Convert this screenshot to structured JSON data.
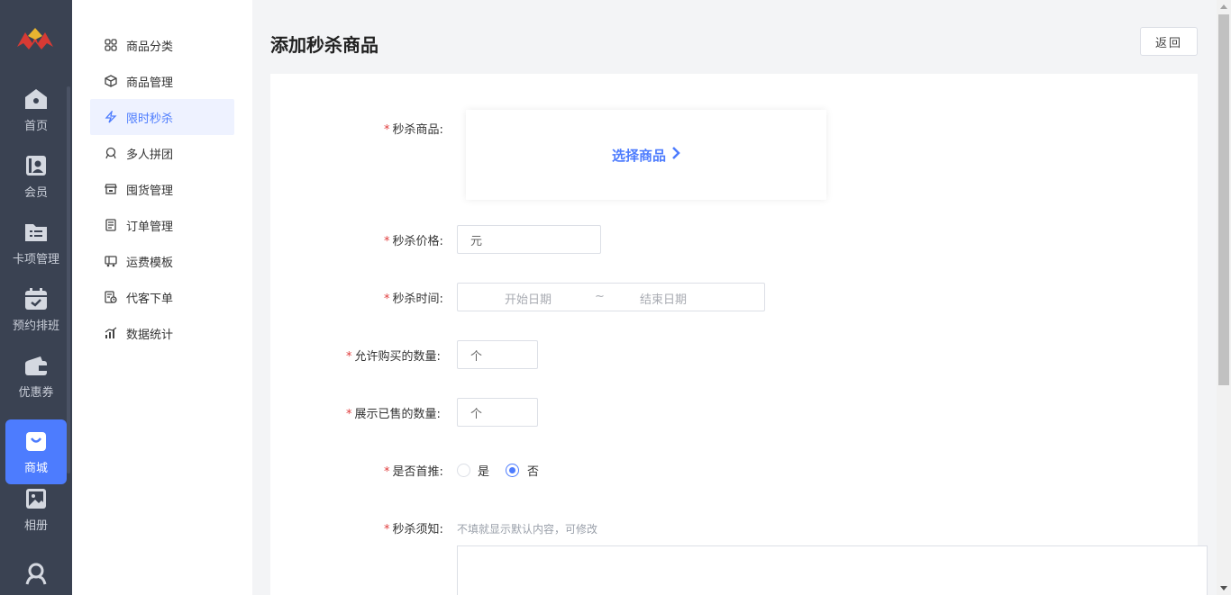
{
  "rail": {
    "items": [
      {
        "label": "首页",
        "icon": "home-icon"
      },
      {
        "label": "会员",
        "icon": "member-card-icon"
      },
      {
        "label": "卡项管理",
        "icon": "folder-list-icon"
      },
      {
        "label": "预约排班",
        "icon": "calendar-check-icon"
      },
      {
        "label": "优惠券",
        "icon": "wallet-icon"
      },
      {
        "label": "商城",
        "icon": "shopping-bag-icon"
      },
      {
        "label": "相册",
        "icon": "photo-album-icon"
      },
      {
        "label": "",
        "icon": "group-icon"
      }
    ]
  },
  "submenu": {
    "items": [
      {
        "label": "商品分类",
        "icon": "grid-icon"
      },
      {
        "label": "商品管理",
        "icon": "box-icon"
      },
      {
        "label": "限时秒杀",
        "icon": "lightning-icon"
      },
      {
        "label": "多人拼团",
        "icon": "people-group-icon"
      },
      {
        "label": "囤货管理",
        "icon": "store-icon"
      },
      {
        "label": "订单管理",
        "icon": "order-list-icon"
      },
      {
        "label": "运费模板",
        "icon": "truck-icon"
      },
      {
        "label": "代客下单",
        "icon": "proxy-order-icon"
      },
      {
        "label": "数据统计",
        "icon": "bar-chart-icon"
      }
    ]
  },
  "header": {
    "title": "添加秒杀商品",
    "back_label": "返回"
  },
  "form": {
    "goods_label": "秒杀商品:",
    "select_goods": "选择商品",
    "price_label": "秒杀价格:",
    "price_placeholder": "元",
    "time_label": "秒杀时间:",
    "start_placeholder": "开始日期",
    "range_sep": "~",
    "end_placeholder": "结束日期",
    "buy_qty_label": "允许购买的数量:",
    "buy_qty_placeholder": "个",
    "sold_qty_label": "展示已售的数量:",
    "sold_qty_placeholder": "个",
    "recommend_label": "是否首推:",
    "opt_yes": "是",
    "opt_no": "否",
    "notice_label": "秒杀须知:",
    "notice_hint": "不填就显示默认内容，可修改",
    "required_mark": "*"
  },
  "colors": {
    "accent": "#4d7cfe",
    "rail_bg": "#3a4252",
    "required": "#e03b3b"
  }
}
